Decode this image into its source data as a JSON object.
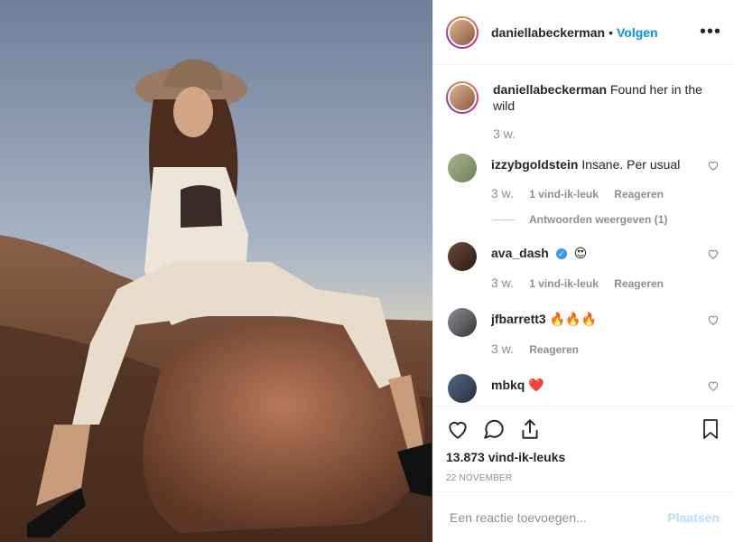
{
  "post": {
    "author": "daniellabeckerman",
    "follow_dot": "•",
    "follow_label": "Volgen",
    "more_label": "•••",
    "caption_user": "daniellabeckerman",
    "caption_text": "Found her in the wild",
    "caption_time": "3 w."
  },
  "comments": [
    {
      "user": "izzybgoldstein",
      "text": "Insane. Per usual",
      "time": "3 w.",
      "likes": "1 vind-ik-leuk",
      "reply": "Reageren",
      "replies_label": "Antwoorden weergeven (1)"
    },
    {
      "user": "ava_dash",
      "text": "😍",
      "verified": "✓",
      "time": "3 w.",
      "likes": "1 vind-ik-leuk",
      "reply": "Reageren"
    },
    {
      "user": "jfbarrett3",
      "text": "🔥🔥🔥",
      "time": "3 w.",
      "reply": "Reageren"
    },
    {
      "user": "mbkq",
      "text": "❤️"
    }
  ],
  "footer": {
    "likes": "13.873 vind-ik-leuks",
    "date": "22 NOVEMBER",
    "comment_placeholder": "Een reactie toevoegen...",
    "post_label": "Plaatsen"
  },
  "icons": [
    "heart-icon",
    "comment-icon",
    "share-icon",
    "bookmark-icon",
    "more-icon"
  ],
  "colors": {
    "accent": "#0095f6",
    "post_disabled": "#b2dffc",
    "muted": "#8e8e8e"
  }
}
